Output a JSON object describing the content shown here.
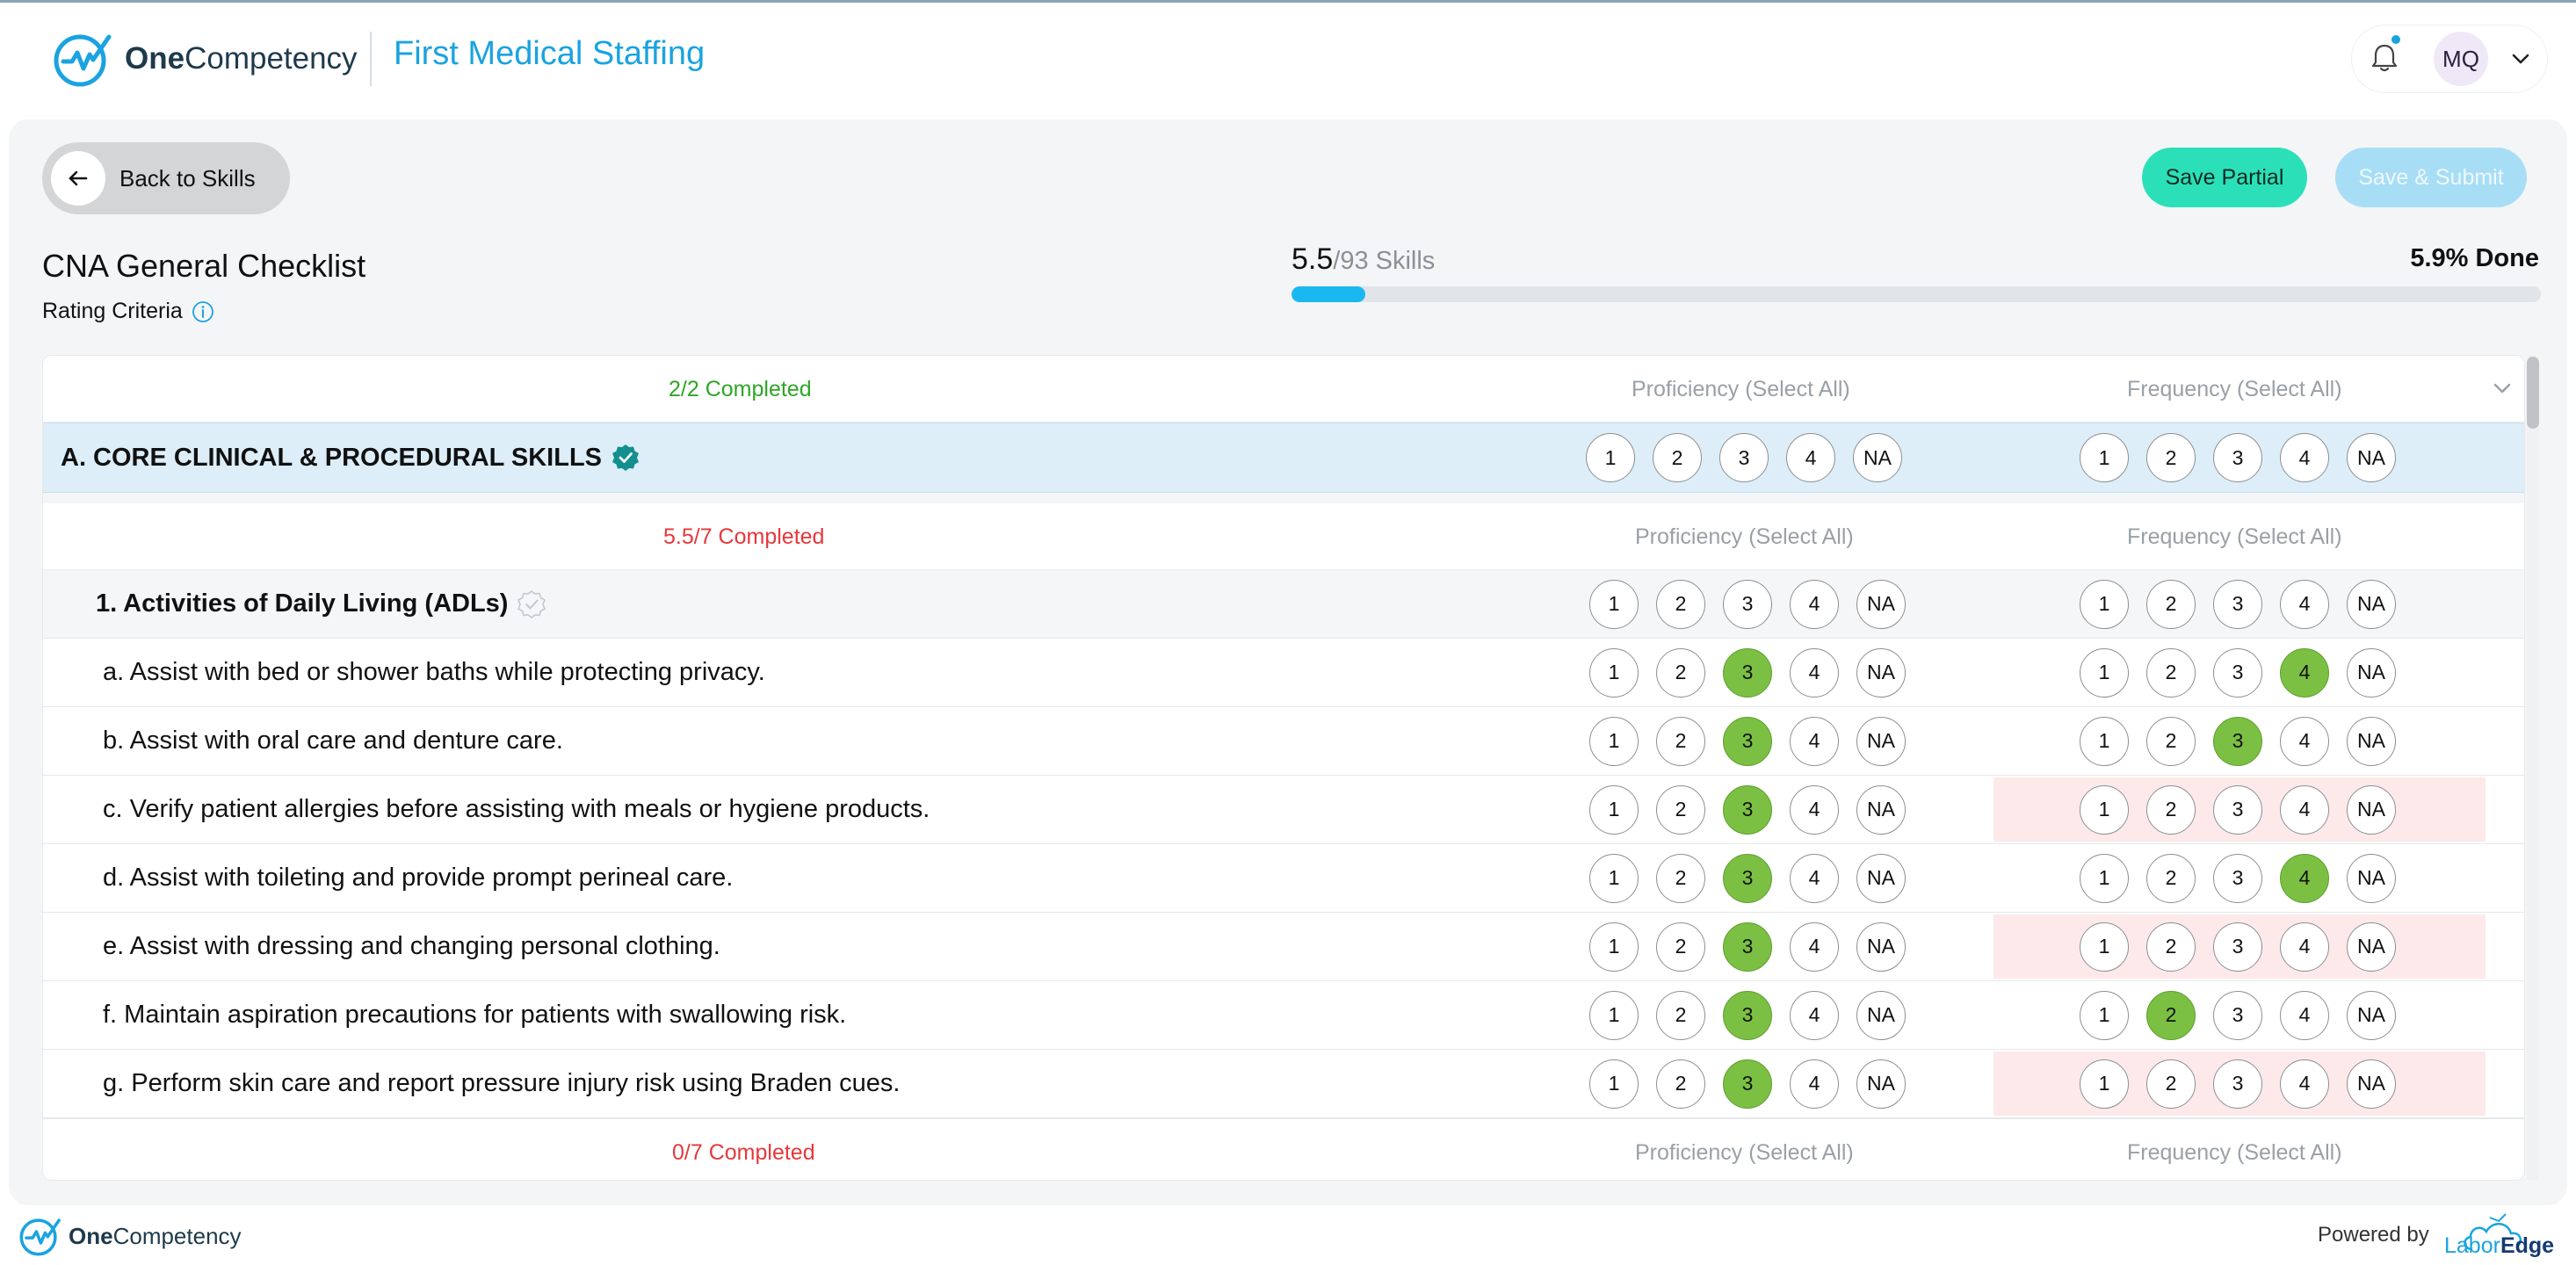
{
  "header": {
    "logo_bold": "One",
    "logo_rest": "Competency",
    "org_name": "First Medical Staffing",
    "user_initials": "MQ"
  },
  "toolbar": {
    "back_label": "Back to Skills",
    "save_partial_label": "Save Partial",
    "save_submit_label": "Save & Submit"
  },
  "checklist": {
    "title": "CNA General Checklist",
    "rating_criteria_label": "Rating Criteria"
  },
  "progress": {
    "done_count": "5.5",
    "total_label": "/93 Skills",
    "percent_label": "5.9% Done",
    "fraction": 0.059
  },
  "columns": {
    "proficiency": "Proficiency (Select All)",
    "frequency": "Frequency (Select All)"
  },
  "rating_options": [
    "1",
    "2",
    "3",
    "4",
    "NA"
  ],
  "section_a": {
    "completed": "2/2 Completed",
    "title": "A. CORE CLINICAL & PROCEDURAL SKILLS"
  },
  "subsection_1": {
    "completed": "5.5/7 Completed",
    "title": "1. Activities of Daily Living (ADLs)"
  },
  "items": [
    {
      "label": "a. Assist with bed or shower baths while protecting privacy.",
      "proficiency": "3",
      "frequency": "4",
      "missing_frequency": false
    },
    {
      "label": "b. Assist with oral care and denture care.",
      "proficiency": "3",
      "frequency": "3",
      "missing_frequency": false
    },
    {
      "label": "c. Verify patient allergies before assisting with meals or hygiene products.",
      "proficiency": "3",
      "frequency": null,
      "missing_frequency": true
    },
    {
      "label": "d. Assist with toileting and provide prompt perineal care.",
      "proficiency": "3",
      "frequency": "4",
      "missing_frequency": false
    },
    {
      "label": "e. Assist with dressing and changing personal clothing.",
      "proficiency": "3",
      "frequency": null,
      "missing_frequency": true
    },
    {
      "label": "f. Maintain aspiration precautions for patients with swallowing risk.",
      "proficiency": "3",
      "frequency": "2",
      "missing_frequency": false
    },
    {
      "label": "g. Perform skin care and report pressure injury risk using Braden cues.",
      "proficiency": "3",
      "frequency": null,
      "missing_frequency": true
    }
  ],
  "next_group": {
    "completed": "0/7 Completed"
  },
  "footer": {
    "logo_bold": "One",
    "logo_rest": "Competency",
    "powered_by": "Powered by",
    "partner_light": "Labor",
    "partner_bold": "Edge"
  },
  "colors": {
    "accent": "#1aa3e0",
    "selected": "#7bc043",
    "save_partial": "#2be0b8",
    "save_submit_disabled": "#a8def5",
    "missing": "#fde9ea",
    "completed_ok": "#2ea626",
    "completed_incomplete": "#e5383b"
  },
  "icons": {
    "logo": "checkmark-pulse-icon",
    "bell": "bell-icon",
    "back": "arrow-left-icon",
    "info": "info-icon",
    "verified": "verified-badge-icon",
    "collapse": "chevron-down-icon"
  }
}
